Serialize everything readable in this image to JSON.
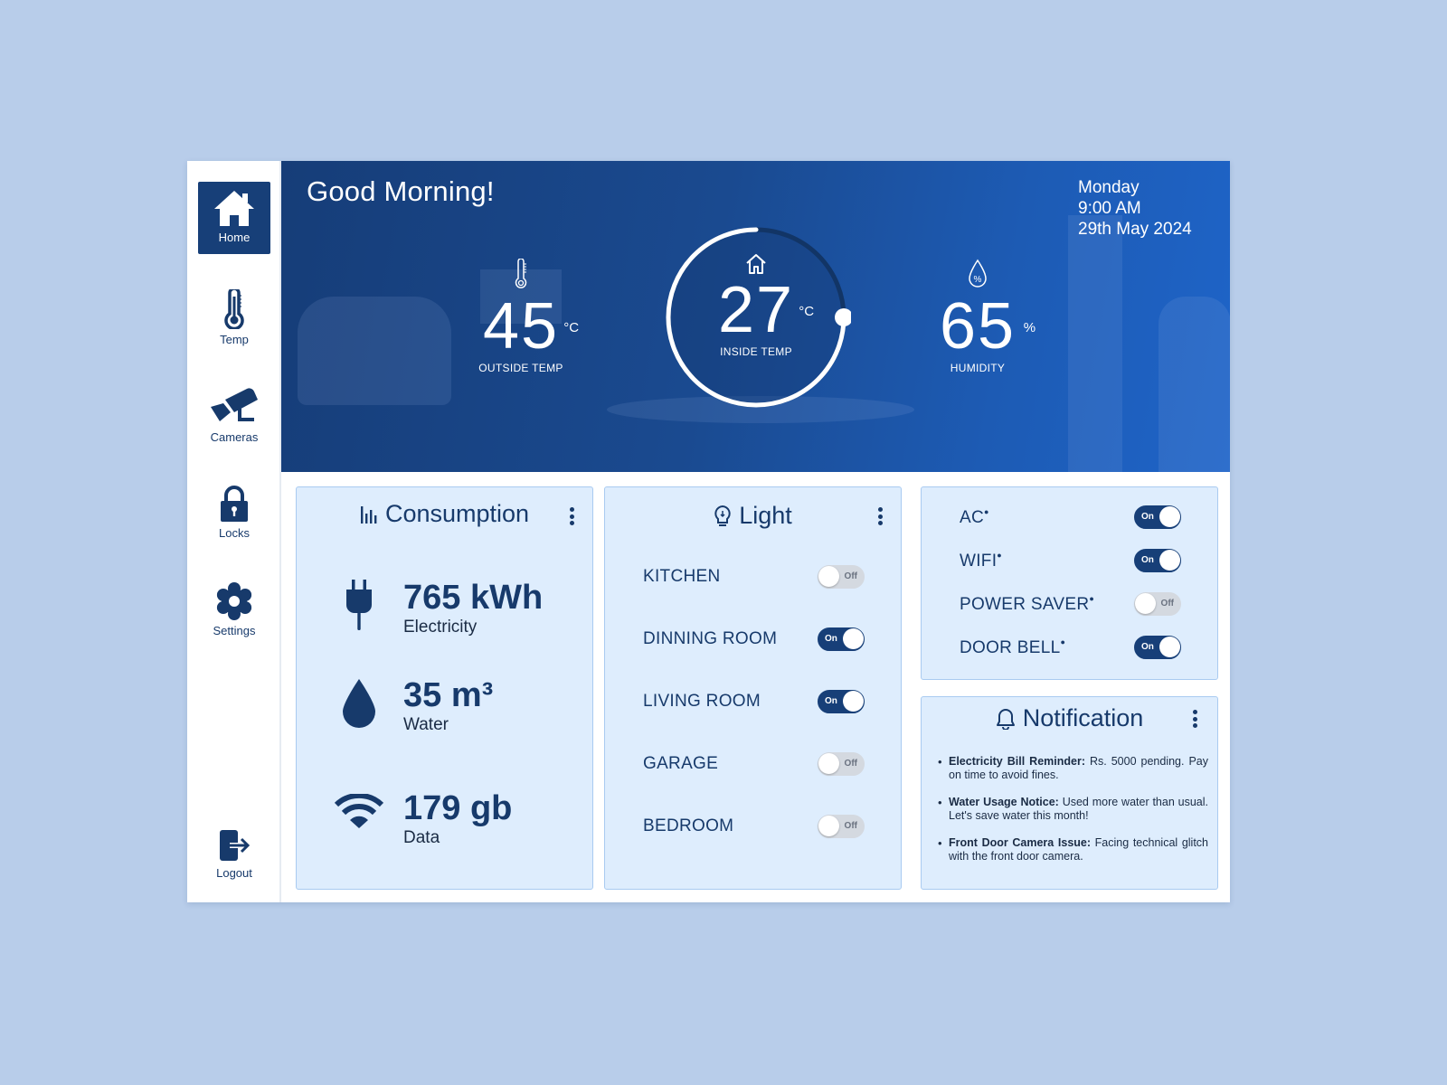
{
  "sidebar": {
    "items": [
      {
        "label": "Home",
        "icon": "home-icon",
        "active": true
      },
      {
        "label": "Temp",
        "icon": "thermometer-icon",
        "active": false
      },
      {
        "label": "Cameras",
        "icon": "camera-icon",
        "active": false
      },
      {
        "label": "Locks",
        "icon": "lock-icon",
        "active": false
      },
      {
        "label": "Settings",
        "icon": "gear-icon",
        "active": false
      }
    ],
    "logout_label": "Logout"
  },
  "hero": {
    "greeting": "Good Morning!",
    "day": "Monday",
    "time": "9:00 AM",
    "date": "29th May 2024",
    "outside": {
      "value": "45",
      "unit": "°C",
      "label": "OUTSIDE TEMP"
    },
    "inside": {
      "value": "27",
      "unit": "°C",
      "label": "INSIDE TEMP",
      "gauge_fraction": 0.75
    },
    "humidity": {
      "value": "65",
      "unit": "%",
      "label": "HUMIDITY"
    }
  },
  "consumption": {
    "title": "Consumption",
    "items": [
      {
        "value": "765 kWh",
        "label": "Electricity",
        "icon": "plug-icon"
      },
      {
        "value": "35 m³",
        "label": "Water",
        "icon": "water-drop-icon"
      },
      {
        "value": "179 gb",
        "label": "Data",
        "icon": "wifi-icon"
      }
    ]
  },
  "light": {
    "title": "Light",
    "rooms": [
      {
        "name": "KITCHEN",
        "state": "off",
        "state_label": "Off"
      },
      {
        "name": "DINNING ROOM",
        "state": "on",
        "state_label": "On"
      },
      {
        "name": "LIVING ROOM",
        "state": "on",
        "state_label": "On"
      },
      {
        "name": "GARAGE",
        "state": "off",
        "state_label": "Off"
      },
      {
        "name": "BEDROOM",
        "state": "off",
        "state_label": "Off"
      }
    ]
  },
  "devices": [
    {
      "name": "AC",
      "state": "on",
      "state_label": "On"
    },
    {
      "name": "WIFI",
      "state": "on",
      "state_label": "On"
    },
    {
      "name": "POWER SAVER",
      "state": "off",
      "state_label": "Off"
    },
    {
      "name": "DOOR BELL",
      "state": "on",
      "state_label": "On"
    }
  ],
  "notification": {
    "title": "Notification",
    "items": [
      {
        "title": "Electricity Bill Reminder:",
        "text": " Rs. 5000 pending. Pay on time to avoid fines."
      },
      {
        "title": "Water Usage Notice:",
        "text": " Used more water than usual. Let's save water this month!"
      },
      {
        "title": "Front Door Camera Issue:",
        "text": " Facing technical glitch with the front door camera."
      }
    ]
  },
  "colors": {
    "page_bg": "#b8cdea",
    "primary": "#173f78",
    "card_bg": "#deedfd",
    "card_border": "#a9cbf1",
    "toggle_off": "#d4d9e0"
  }
}
